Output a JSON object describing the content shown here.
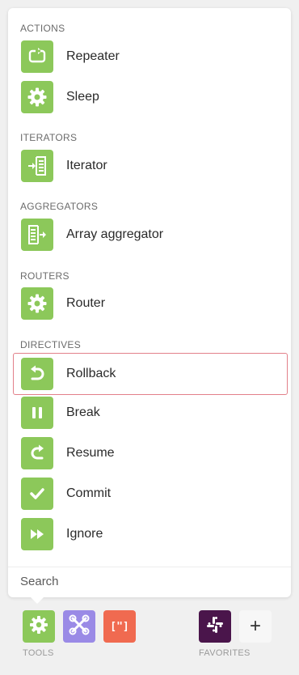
{
  "sections": {
    "actions": "ACTIONS",
    "iterators": "ITERATORS",
    "aggregators": "AGGREGATORS",
    "routers": "ROUTERS",
    "directives": "DIRECTIVES"
  },
  "items": {
    "repeater": "Repeater",
    "sleep": "Sleep",
    "iterator": "Iterator",
    "array_aggregator": "Array aggregator",
    "router": "Router",
    "rollback": "Rollback",
    "break": "Break",
    "resume": "Resume",
    "commit": "Commit",
    "ignore": "Ignore"
  },
  "search": {
    "placeholder": "Search"
  },
  "dock": {
    "tools_label": "TOOLS",
    "favorites_label": "FAVORITES",
    "add_glyph": "+",
    "json_glyph": "[\"]"
  },
  "colors": {
    "module_green": "#8cc85a",
    "flow_purple": "#9a8ae6",
    "json_orange": "#f06a50",
    "slack_aubergine": "#4a154b",
    "selection_border": "#e2808a"
  },
  "selected_item": "Rollback"
}
